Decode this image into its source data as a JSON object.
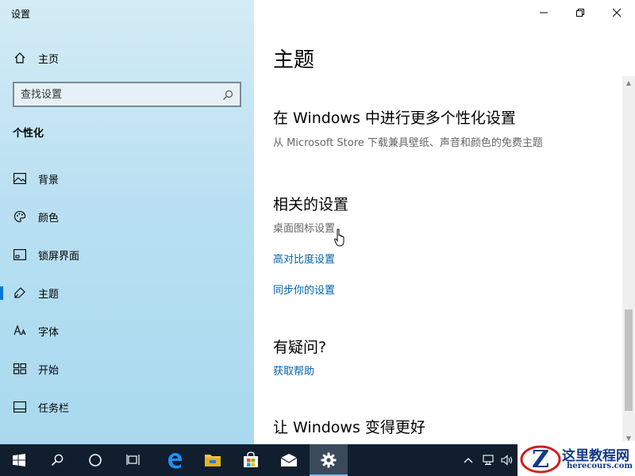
{
  "app": {
    "title": "设置"
  },
  "sidebar": {
    "home_label": "主页",
    "search_placeholder": "查找设置",
    "section": "个性化",
    "items": [
      {
        "label": "背景",
        "icon": "picture-icon"
      },
      {
        "label": "颜色",
        "icon": "palette-icon"
      },
      {
        "label": "锁屏界面",
        "icon": "lock-screen-icon"
      },
      {
        "label": "主题",
        "icon": "theme-icon",
        "active": true
      },
      {
        "label": "字体",
        "icon": "font-icon"
      },
      {
        "label": "开始",
        "icon": "start-tiles-icon"
      },
      {
        "label": "任务栏",
        "icon": "taskbar-icon"
      }
    ]
  },
  "main": {
    "title": "主题",
    "store_heading": "在 Windows 中进行更多个性化设置",
    "store_desc": "从 Microsoft Store 下载兼具壁纸、声音和颜色的免费主题",
    "related_heading": "相关的设置",
    "related_links": [
      "桌面图标设置",
      "高对比度设置",
      "同步你的设置"
    ],
    "help_heading": "有疑问?",
    "help_link": "获取帮助",
    "improve_heading": "让 Windows 变得更好"
  },
  "taskbar": {
    "buttons": [
      "start-icon",
      "search-icon",
      "cortana-icon",
      "task-view-icon",
      "edge-icon",
      "file-explorer-icon",
      "store-icon",
      "mail-icon",
      "settings-icon"
    ],
    "tray": [
      "chevron-up-icon",
      "network-icon",
      "volume-icon"
    ]
  },
  "watermark": {
    "name": "这里教程网",
    "url": "herecours.com"
  },
  "colors": {
    "accent": "#0078d7",
    "link": "#0063b1",
    "taskbar": "#101e2e"
  }
}
